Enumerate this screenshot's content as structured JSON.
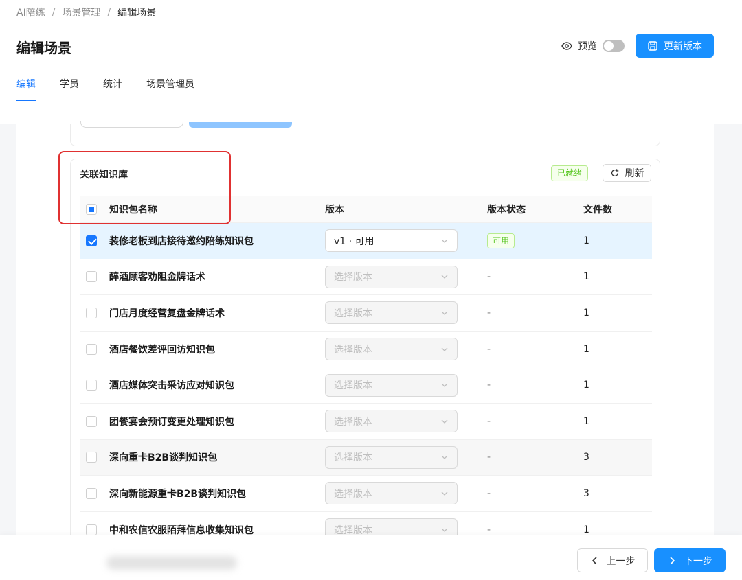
{
  "breadcrumb": {
    "items": [
      "AI陪练",
      "场景管理",
      "编辑场景"
    ],
    "separator": "/"
  },
  "page": {
    "title": "编辑场景"
  },
  "header": {
    "preview_label": "预览",
    "preview_enabled": false,
    "update_button": "更新版本"
  },
  "tabs": [
    {
      "label": "编辑",
      "active": true
    },
    {
      "label": "学员",
      "active": false
    },
    {
      "label": "统计",
      "active": false
    },
    {
      "label": "场景管理员",
      "active": false
    }
  ],
  "knowledge": {
    "title": "关联知识库",
    "status_badge": "已就绪",
    "refresh_button": "刷新",
    "columns": {
      "name": "知识包名称",
      "version": "版本",
      "version_status": "版本状态",
      "file_count": "文件数"
    },
    "rows": [
      {
        "name": "装修老板到店接待邀约陪练知识包",
        "version": "v1 · 可用",
        "status": "可用",
        "files": "1",
        "checked": true
      },
      {
        "name": "醉酒顾客劝阻金牌话术",
        "version": "选择版本",
        "status": "-",
        "files": "1",
        "checked": false
      },
      {
        "name": "门店月度经营复盘金牌话术",
        "version": "选择版本",
        "status": "-",
        "files": "1",
        "checked": false
      },
      {
        "name": "酒店餐饮差评回访知识包",
        "version": "选择版本",
        "status": "-",
        "files": "1",
        "checked": false
      },
      {
        "name": "酒店媒体突击采访应对知识包",
        "version": "选择版本",
        "status": "-",
        "files": "1",
        "checked": false
      },
      {
        "name": "团餐宴会预订变更处理知识包",
        "version": "选择版本",
        "status": "-",
        "files": "1",
        "checked": false
      },
      {
        "name": "深向重卡B2B谈判知识包",
        "version": "选择版本",
        "status": "-",
        "files": "3",
        "checked": false
      },
      {
        "name": "深向新能源重卡B2B谈判知识包",
        "version": "选择版本",
        "status": "-",
        "files": "3",
        "checked": false
      },
      {
        "name": "中和农信农服陌拜信息收集知识包",
        "version": "选择版本",
        "status": "-",
        "files": "1",
        "checked": false
      }
    ]
  },
  "footer": {
    "prev_button": "上一步",
    "next_button": "下一步"
  },
  "colors": {
    "primary": "#1890ff",
    "success": "#52c41a",
    "highlight": "#e03131"
  }
}
